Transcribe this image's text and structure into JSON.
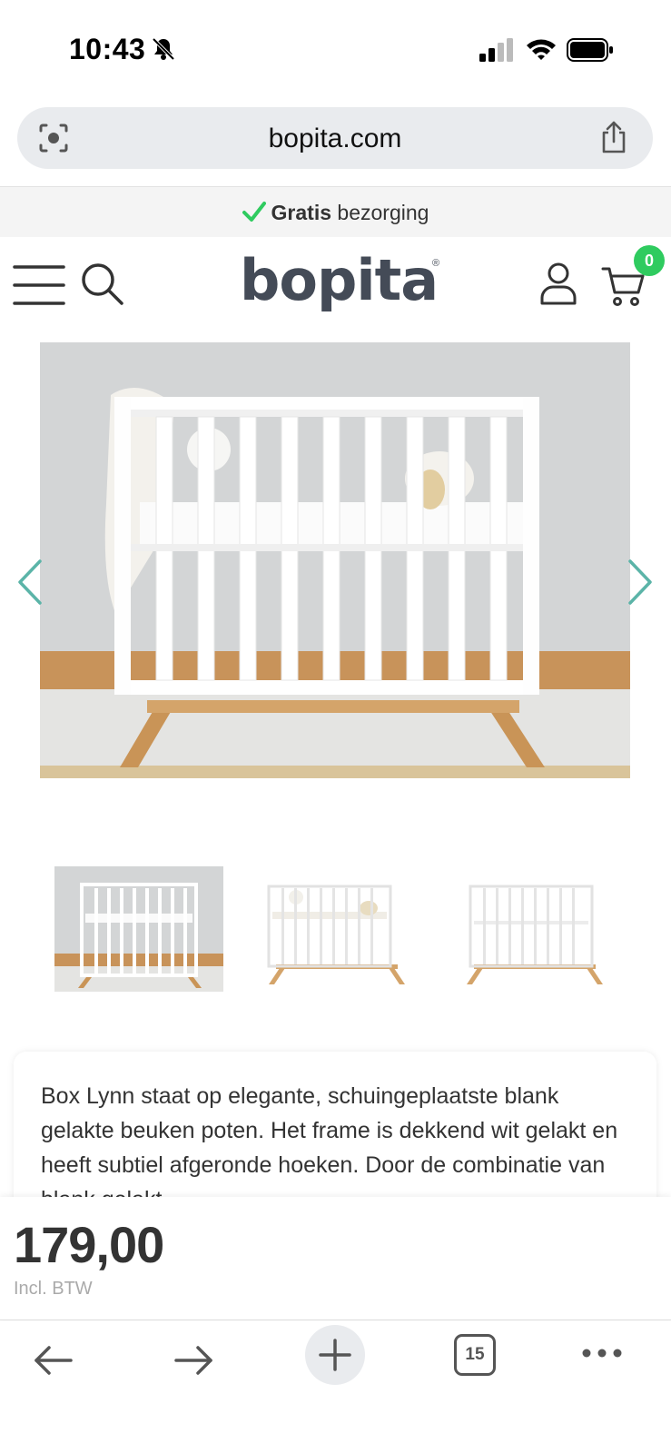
{
  "status_bar": {
    "time": "10:43"
  },
  "url_bar": {
    "url": "bopita.com"
  },
  "promo": {
    "bold": "Gratis",
    "text": " bezorging"
  },
  "header": {
    "logo": "bopita",
    "logo_mark": "®",
    "cart_count": "0"
  },
  "gallery": {
    "thumbnail_count": 3,
    "active_thumbnail": 1
  },
  "description": {
    "text": "Box Lynn staat op elegante, schuingeplaatste blank gelakte beuken poten. Het frame is dekkend wit gelakt en heeft subtiel afgeronde hoeken. Door de combinatie van blank gelakt"
  },
  "price": {
    "amount": "179,00",
    "note": "Incl. BTW"
  },
  "toolbar": {
    "tab_count": "15"
  },
  "colors": {
    "accent_green": "#2fcb5f",
    "arrow_teal": "#5bb4a8",
    "logo_gray": "#444b57"
  },
  "icons": [
    "bell-slash-icon",
    "signal-icon",
    "wifi-icon",
    "battery-icon",
    "lens-icon",
    "share-icon",
    "check-icon",
    "menu-icon",
    "search-icon",
    "account-icon",
    "cart-icon",
    "chevron-left-icon",
    "chevron-right-icon",
    "back-icon",
    "forward-icon",
    "plus-icon",
    "more-icon"
  ]
}
